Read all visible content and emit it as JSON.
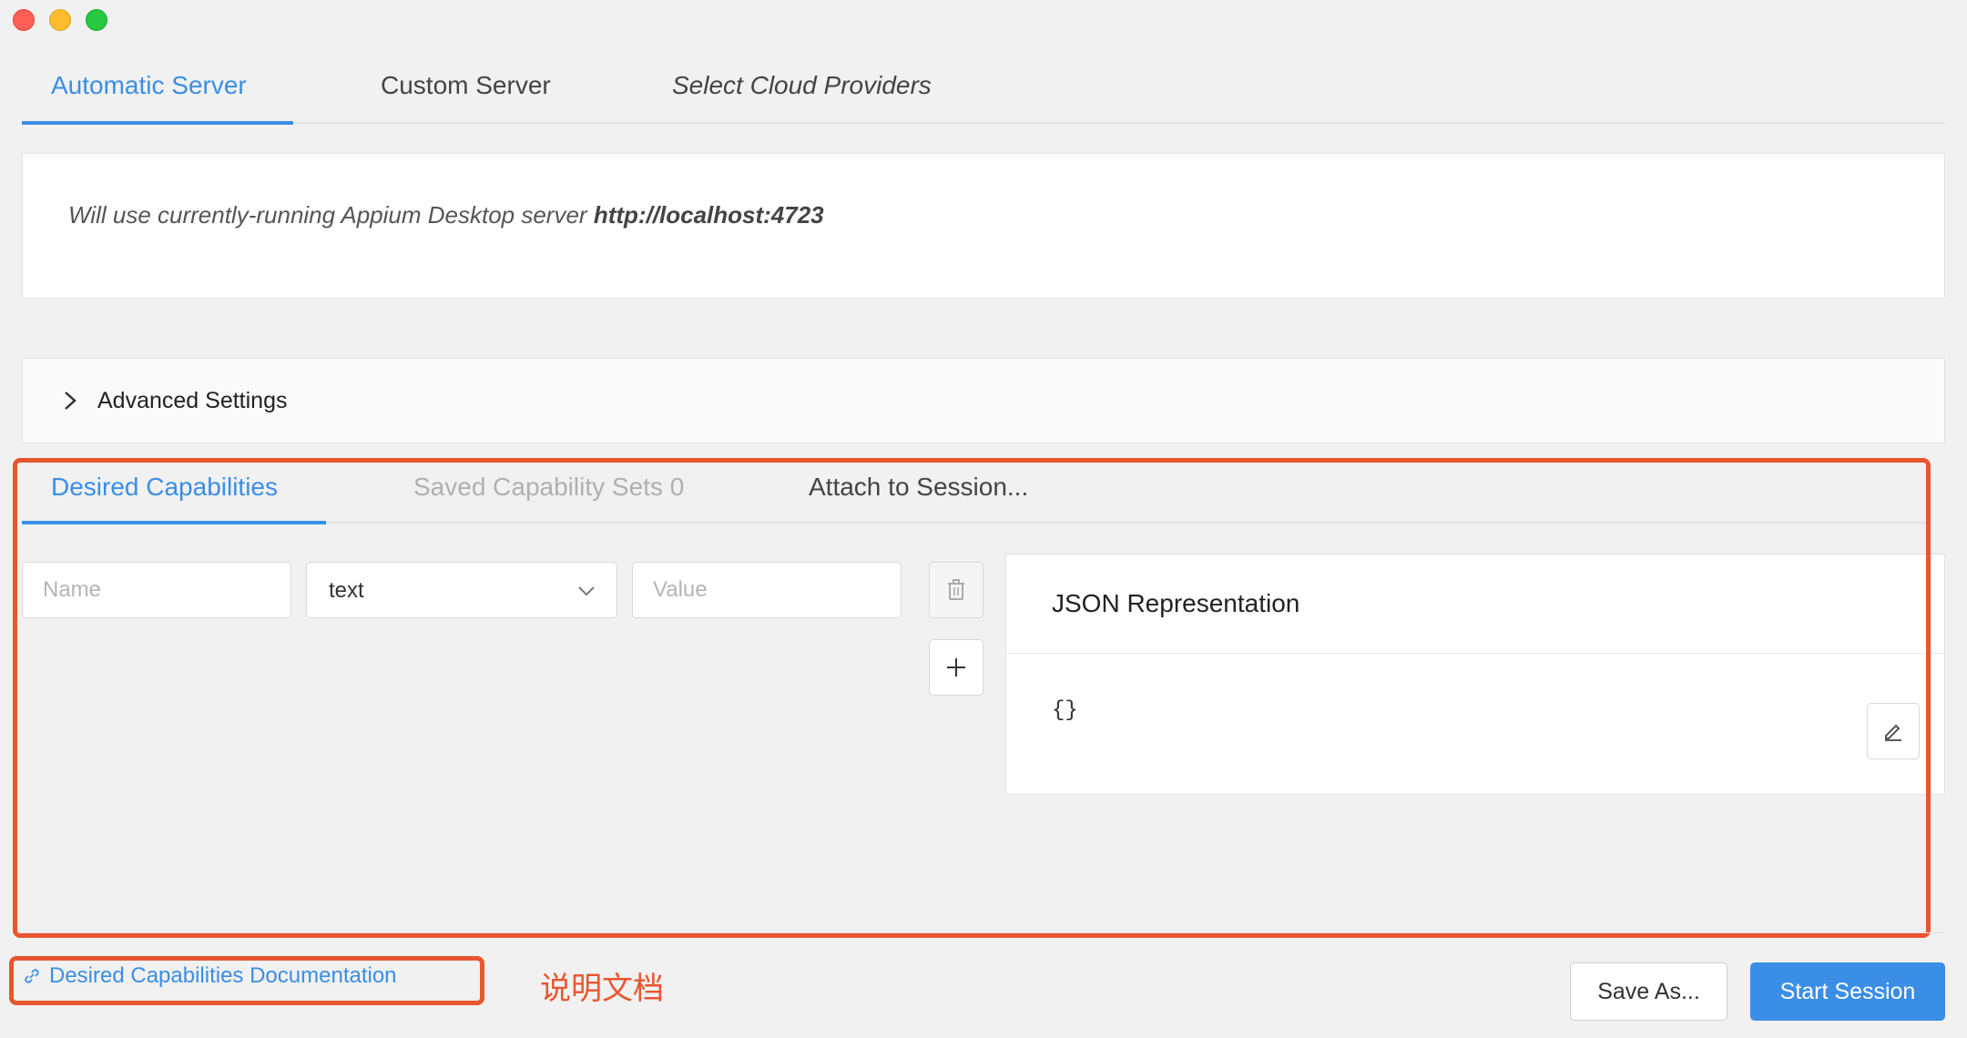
{
  "server_tabs": [
    {
      "label": "Automatic Server",
      "active": true
    },
    {
      "label": "Custom Server",
      "active": false
    },
    {
      "label": "Select Cloud Providers",
      "active": false
    }
  ],
  "server_info": {
    "text": "Will use currently-running Appium Desktop server",
    "url": "http://localhost:4723"
  },
  "advanced": {
    "label": "Advanced Settings",
    "icon": "chevron-right-icon"
  },
  "capability_tabs": [
    {
      "label": "Desired Capabilities",
      "active": true
    },
    {
      "label": "Saved Capability Sets 0",
      "disabled": true
    },
    {
      "label": "Attach to Session...",
      "active": false
    }
  ],
  "capability_row": {
    "name_placeholder": "Name",
    "type_value": "text",
    "value_placeholder": "Value"
  },
  "json_panel": {
    "title": "JSON Representation",
    "body": "{}"
  },
  "doc_link": {
    "label": "Desired Capabilities Documentation",
    "icon": "link-icon"
  },
  "annotation": {
    "label": "说明文档",
    "color": "#e9552f"
  },
  "buttons": {
    "save_as": "Save As...",
    "start_session": "Start Session"
  },
  "colors": {
    "accent": "#3a8ee6",
    "annotation": "#e9552f"
  }
}
